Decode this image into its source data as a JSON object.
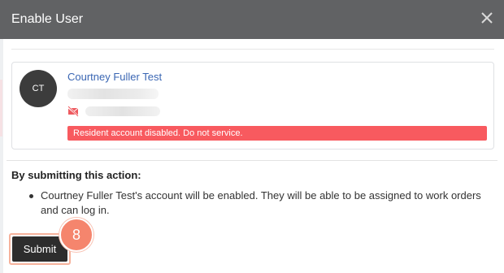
{
  "dialog": {
    "title": "Enable User",
    "close_icon": "close-icon"
  },
  "user": {
    "avatar_initials": "CT",
    "name": "Courtney Fuller Test",
    "status_message": "Resident account disabled. Do not service.",
    "status_color": "#f85a5f",
    "email_icon": "no-email-icon"
  },
  "action": {
    "heading": "By submitting this action:",
    "items": [
      "Courtney Fuller Test's account will be enabled. They will be able to be assigned to work orders and can log in."
    ]
  },
  "footer": {
    "submit_label": "Submit",
    "step_number": "8",
    "step_color": "#f5856d"
  },
  "colors": {
    "header_bg": "#616264",
    "link": "#3a66b3",
    "button_bg": "#2d2d2d"
  }
}
